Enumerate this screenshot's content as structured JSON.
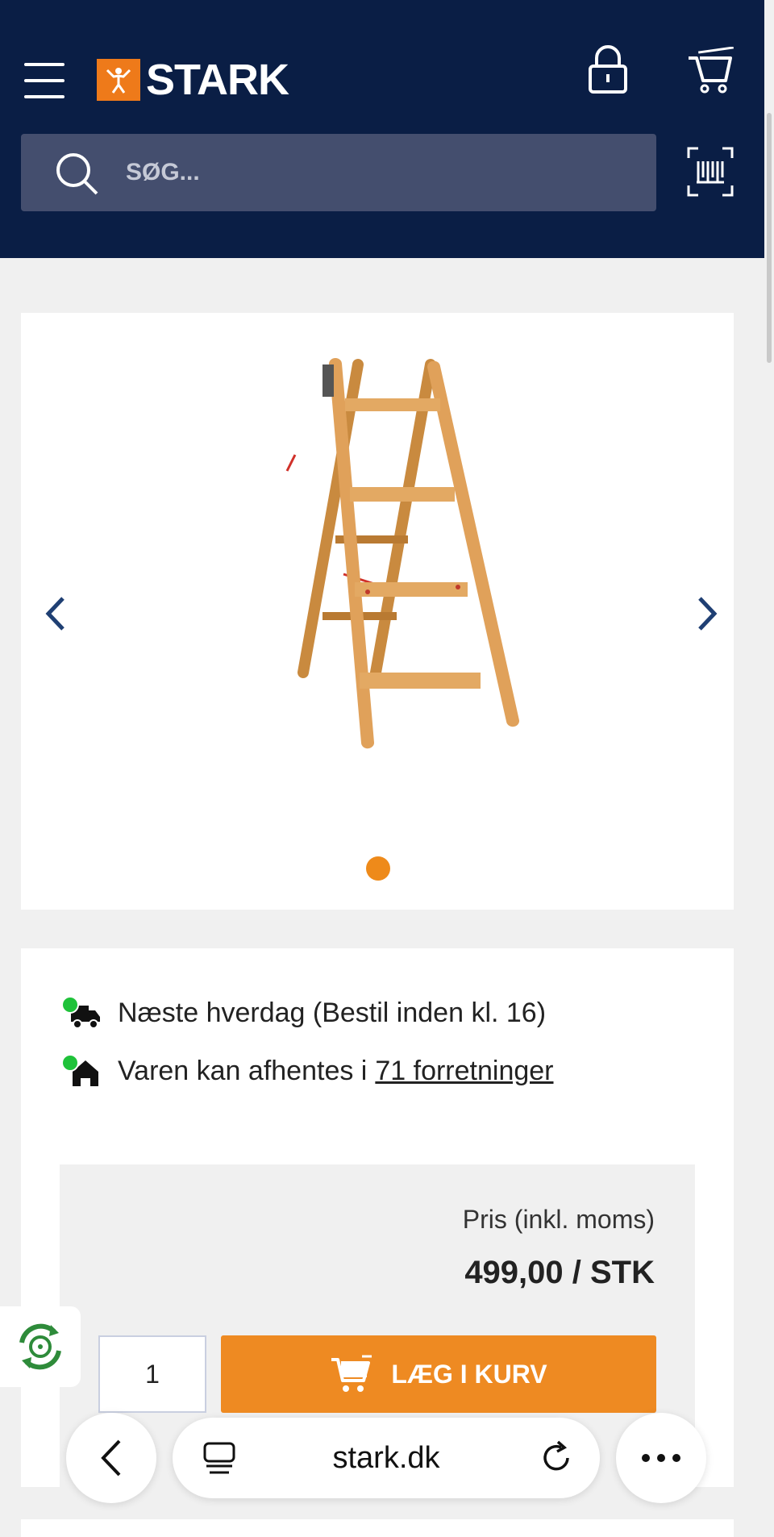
{
  "header": {
    "logo_text": "STARK",
    "brand_color": "#0a1e45",
    "accent_color": "#ee7a1a"
  },
  "search": {
    "placeholder": "SØG..."
  },
  "gallery": {
    "image": "wooden-step-ladder",
    "slide_count": 1,
    "active_slide": 1
  },
  "availability": {
    "delivery_text": "Næste hverdag (Bestil inden kl. 16)",
    "pickup_text": "Varen kan afhentes i",
    "pickup_link": "71 forretninger",
    "status_color": "#1fc23a"
  },
  "price": {
    "label": "Pris (inkl. moms)",
    "value": "499,00 / STK"
  },
  "cart_form": {
    "quantity": "1",
    "add_button_label": "LÆG I KURV",
    "button_color": "#ee8a22"
  },
  "browser": {
    "url": "stark.dk"
  }
}
